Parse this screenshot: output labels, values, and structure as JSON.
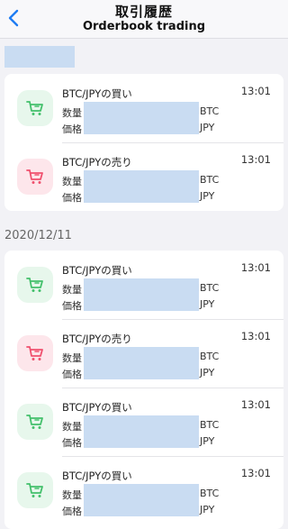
{
  "header": {
    "title": "取引履歴",
    "subtitle": "Orderbook trading",
    "back_icon": "chevron-left-icon",
    "accent": "#1e7cf2"
  },
  "sections": [
    {
      "date": ""
    },
    {
      "date": "2020/12/11"
    }
  ],
  "labels": {
    "quantity": "数量",
    "price": "価格"
  },
  "colors": {
    "buy_icon": "#43c06b",
    "buy_bg": "#e7f7ec",
    "sell_icon": "#f0506e",
    "sell_bg": "#fde6eb",
    "redaction": "#c9dcf2"
  },
  "trades": [
    {
      "title": "BTC/JPYの買い",
      "time": "13:01",
      "type": "buy",
      "qty_unit": "BTC",
      "price_unit": "JPY",
      "icon": "cart-icon"
    },
    {
      "title": "BTC/JPYの売り",
      "time": "13:01",
      "type": "sell",
      "qty_unit": "BTC",
      "price_unit": "JPY",
      "icon": "cart-icon"
    },
    {
      "title": "BTC/JPYの買い",
      "time": "13:01",
      "type": "buy",
      "qty_unit": "BTC",
      "price_unit": "JPY",
      "icon": "cart-icon"
    },
    {
      "title": "BTC/JPYの売り",
      "time": "13:01",
      "type": "sell",
      "qty_unit": "BTC",
      "price_unit": "JPY",
      "icon": "cart-icon"
    },
    {
      "title": "BTC/JPYの買い",
      "time": "13:01",
      "type": "buy",
      "qty_unit": "BTC",
      "price_unit": "JPY",
      "icon": "cart-icon"
    },
    {
      "title": "BTC/JPYの買い",
      "time": "13:01",
      "type": "buy",
      "qty_unit": "BTC",
      "price_unit": "JPY",
      "icon": "cart-icon"
    }
  ]
}
